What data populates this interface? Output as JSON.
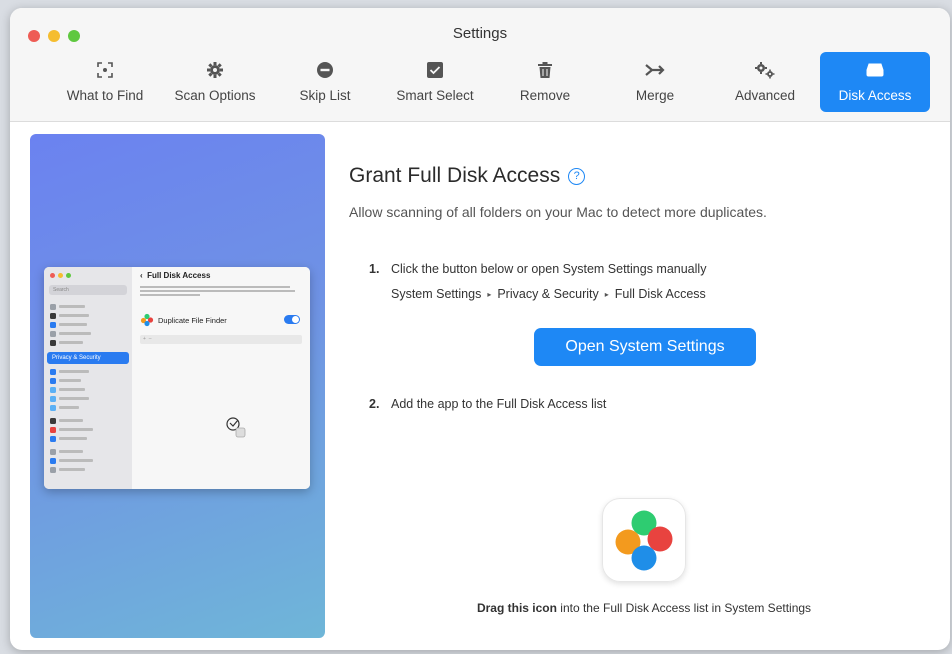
{
  "window": {
    "title": "Settings"
  },
  "toolbar": {
    "items": [
      {
        "label": "What to Find",
        "icon": "viewfinder-icon",
        "active": false
      },
      {
        "label": "Scan Options",
        "icon": "gear-icon",
        "active": false
      },
      {
        "label": "Skip List",
        "icon": "minus-circle-icon",
        "active": false
      },
      {
        "label": "Smart Select",
        "icon": "checkbox-icon",
        "active": false
      },
      {
        "label": "Remove",
        "icon": "trash-icon",
        "active": false
      },
      {
        "label": "Merge",
        "icon": "merge-icon",
        "active": false
      },
      {
        "label": "Advanced",
        "icon": "gears-icon",
        "active": false
      },
      {
        "label": "Disk Access",
        "icon": "disk-icon",
        "active": true
      }
    ],
    "active_color": "#1e88f5"
  },
  "preview": {
    "search_placeholder": "Search",
    "highlight_item": "Privacy & Security",
    "panel_title": "Full Disk Access",
    "app_name": "Duplicate File Finder"
  },
  "content": {
    "heading": "Grant Full Disk Access",
    "subheading": "Allow scanning of all folders on your Mac to detect more duplicates.",
    "step1": {
      "number": "1.",
      "text": "Click the button below or open System Settings manually"
    },
    "path": [
      "System Settings",
      "Privacy & Security",
      "Full Disk Access"
    ],
    "path_separator": "▸",
    "button_label": "Open System Settings",
    "step2": {
      "number": "2.",
      "text": "Add the app to the Full Disk Access list"
    },
    "drag_bold": "Drag this icon",
    "drag_rest": " into the Full Disk Access list in System Settings"
  },
  "colors": {
    "accent": "#1e88f5",
    "icon_green": "#2ecc71",
    "icon_red": "#e8433f",
    "icon_orange": "#f39a1e",
    "icon_blue": "#1f8ee8"
  }
}
